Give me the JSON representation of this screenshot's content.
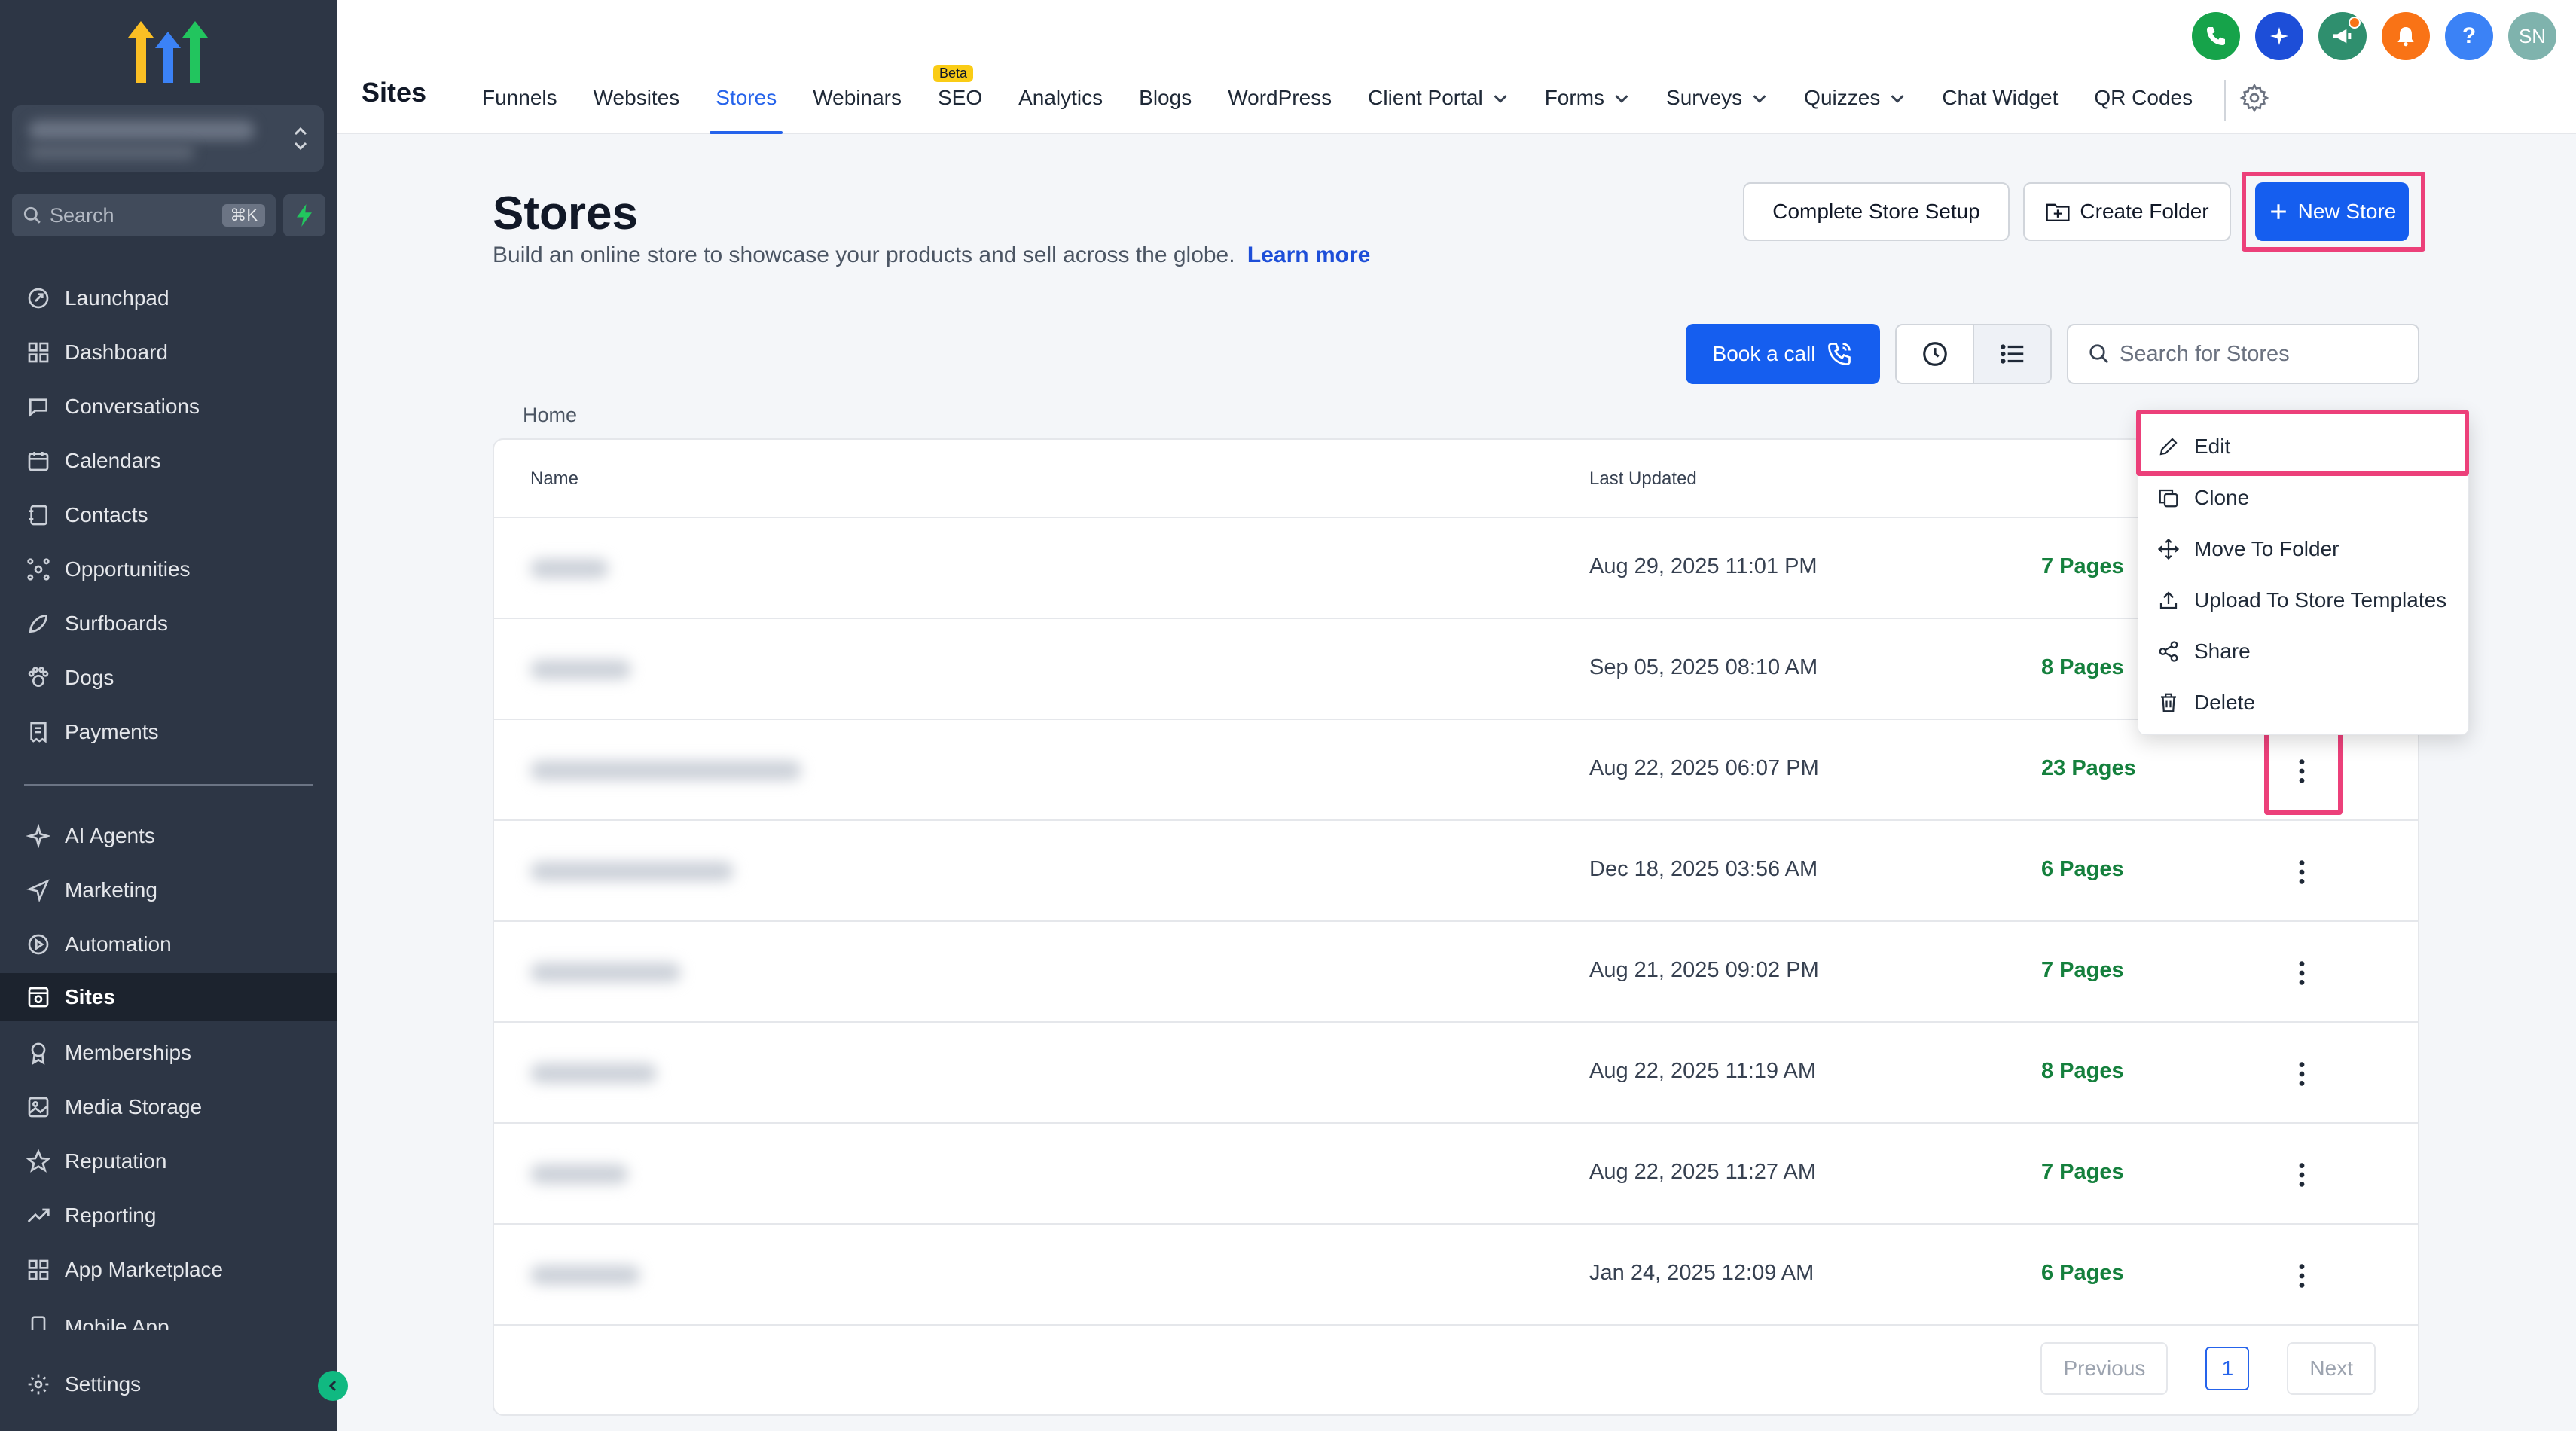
{
  "sidebar": {
    "search_placeholder": "Search",
    "search_shortcut": "⌘K",
    "items_top": [
      {
        "label": "Launchpad",
        "icon": "rocket-icon"
      },
      {
        "label": "Dashboard",
        "icon": "grid-icon"
      },
      {
        "label": "Conversations",
        "icon": "chat-icon"
      },
      {
        "label": "Calendars",
        "icon": "calendar-icon"
      },
      {
        "label": "Contacts",
        "icon": "contacts-icon"
      },
      {
        "label": "Opportunities",
        "icon": "network-icon"
      },
      {
        "label": "Surfboards",
        "icon": "surfboard-icon"
      },
      {
        "label": "Dogs",
        "icon": "paw-icon"
      },
      {
        "label": "Payments",
        "icon": "receipt-icon"
      }
    ],
    "items_bottom": [
      {
        "label": "AI Agents",
        "icon": "sparkle-icon"
      },
      {
        "label": "Marketing",
        "icon": "send-icon"
      },
      {
        "label": "Automation",
        "icon": "automation-icon"
      },
      {
        "label": "Sites",
        "icon": "sites-icon",
        "active": true
      },
      {
        "label": "Memberships",
        "icon": "award-icon"
      },
      {
        "label": "Media Storage",
        "icon": "image-icon"
      },
      {
        "label": "Reputation",
        "icon": "star-icon"
      },
      {
        "label": "Reporting",
        "icon": "trend-icon"
      },
      {
        "label": "App Marketplace",
        "icon": "apps-icon"
      },
      {
        "label": "Mobile App",
        "icon": "phone-icon"
      }
    ],
    "settings_label": "Settings"
  },
  "topbar": {
    "section_title": "Sites",
    "tabs": [
      {
        "label": "Funnels"
      },
      {
        "label": "Websites"
      },
      {
        "label": "Stores",
        "active": true
      },
      {
        "label": "Webinars"
      },
      {
        "label": "SEO",
        "badge": "Beta"
      },
      {
        "label": "Analytics"
      },
      {
        "label": "Blogs"
      },
      {
        "label": "WordPress"
      },
      {
        "label": "Client Portal",
        "dropdown": true
      },
      {
        "label": "Forms",
        "dropdown": true
      },
      {
        "label": "Surveys",
        "dropdown": true
      },
      {
        "label": "Quizzes",
        "dropdown": true
      },
      {
        "label": "Chat Widget"
      },
      {
        "label": "QR Codes"
      }
    ],
    "avatar_initials": "SN",
    "help_label": "?"
  },
  "main": {
    "title": "Stores",
    "subtitle": "Build an online store to showcase your products and sell across the globe.",
    "learn_more": "Learn more",
    "complete_setup_label": "Complete Store Setup",
    "create_folder_label": "Create Folder",
    "new_store_label": "New Store",
    "book_call_label": "Book a call",
    "search_placeholder": "Search for Stores",
    "breadcrumb": "Home",
    "table": {
      "col_name": "Name",
      "col_updated": "Last Updated",
      "rows": [
        {
          "date": "Aug 29, 2025 11:01 PM",
          "pages": "7 Pages"
        },
        {
          "date": "Sep 05, 2025 08:10 AM",
          "pages": "8 Pages"
        },
        {
          "date": "Aug 22, 2025 06:07 PM",
          "pages": "23 Pages"
        },
        {
          "date": "Dec 18, 2025 03:56 AM",
          "pages": "6 Pages"
        },
        {
          "date": "Aug 21, 2025 09:02 PM",
          "pages": "7 Pages"
        },
        {
          "date": "Aug 22, 2025 11:19 AM",
          "pages": "8 Pages"
        },
        {
          "date": "Aug 22, 2025 11:27 AM",
          "pages": "7 Pages"
        },
        {
          "date": "Jan 24, 2025 12:09 AM",
          "pages": "6 Pages"
        }
      ]
    },
    "pagination": {
      "previous": "Previous",
      "current": "1",
      "next": "Next"
    },
    "row_menu": {
      "items": [
        "Edit",
        "Clone",
        "Move To Folder",
        "Upload To Store Templates",
        "Share",
        "Delete"
      ]
    }
  },
  "colors": {
    "sidebar_bg": "#2d3645",
    "primary": "#155eef",
    "highlight": "#ec407a",
    "pages_green": "#15803d"
  }
}
